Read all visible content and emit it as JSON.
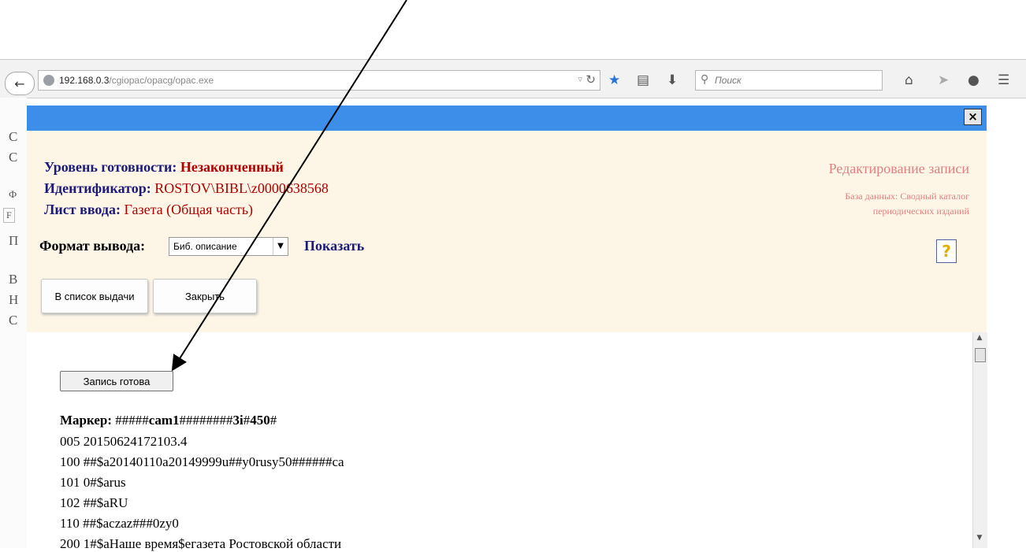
{
  "browser": {
    "url_host": "192.168.0.3",
    "url_path": "/cgiopac/opacg/opac.exe",
    "search_placeholder": "Поиск",
    "icons": {
      "back": "back-arrow-icon",
      "reload": "reload-icon",
      "bookmark": "star-icon",
      "library": "clipboard-icon",
      "download": "download-icon",
      "search": "search-icon",
      "home": "home-icon",
      "pocket": "send-icon",
      "hello": "chat-icon",
      "menu": "menu-icon"
    }
  },
  "background_page": {
    "letters": [
      "С",
      "С",
      "Ф",
      "F",
      "П",
      "В",
      "Н",
      "С"
    ]
  },
  "modal": {
    "close_label": "×",
    "readiness_label": "Уровень готовности:",
    "readiness_value": "Незаконченный",
    "id_label": "Идентификатор:",
    "id_value": "ROSTOV\\BIBL\\z0000638568",
    "sheet_label": "Лист ввода:",
    "sheet_value": "Газета (Общая часть)",
    "edit_title": "Редактирование записи",
    "db_line1": "База данных: Сводный каталог",
    "db_line2": "периодических изданий",
    "format_label": "Формат вывода:",
    "format_value": "Биб. описание",
    "show_link": "Показать",
    "btn_to_list": "В список выдачи",
    "btn_close": "Закрыть",
    "help_icon": "help-question-icon"
  },
  "record": {
    "ready_button": "Запись готова",
    "marker_label": "Маркер:",
    "marker_parts": [
      "#####",
      "cam1",
      "########",
      "3i",
      "#",
      "450",
      "#"
    ],
    "lines": [
      "005 20150624172103.4",
      "100 ##$a20140110a20149999u##y0rusy50######ca",
      "101 0#$arus",
      "102 ##$aRU",
      "110 ##$aczaz###0zy0",
      "200 1#$aНаше время$eгазета Ростовской области"
    ]
  },
  "colors": {
    "header_blue": "#3c8ee9",
    "panel_bg": "#fdf6e6",
    "label_navy": "#1c1a7a",
    "value_red": "#b00000",
    "title_pink": "#e08080"
  }
}
